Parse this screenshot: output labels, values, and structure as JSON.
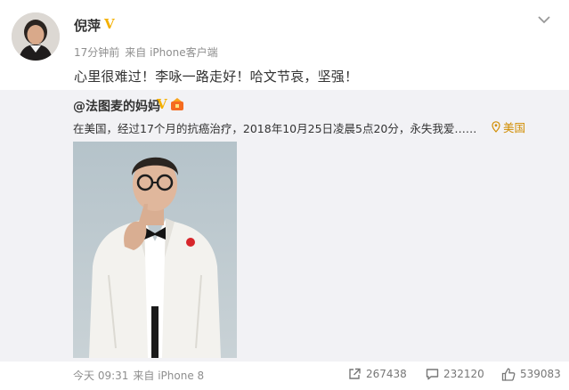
{
  "post": {
    "author": "倪萍",
    "verified_mark": "V",
    "time_ago": "17分钟前",
    "source": "来自 iPhone客户端",
    "text": "心里很难过！李咏一路走好！哈文节哀，坚强！",
    "menu_icon": "chevron-down-icon",
    "avatar_icon": "avatar"
  },
  "repost": {
    "author": "@法图麦的妈妈",
    "verified_mark": "V",
    "badge_icon": "member-badge-icon",
    "text": "在美国，经过17个月的抗癌治疗，2018年10月25日凌晨5点20分，永失我爱……",
    "location": "美国",
    "location_icon": "location-pin-icon",
    "photo_icon": "photo"
  },
  "footer": {
    "time": "今天 09:31",
    "source": "来自 iPhone 8",
    "repost_count": "267438",
    "comment_count": "232120",
    "like_count": "539083",
    "repost_icon": "repost-icon",
    "comment_icon": "comment-icon",
    "like_icon": "thumbs-up-icon"
  },
  "colors": {
    "verified": "#f4b000",
    "location": "#d18d00",
    "muted": "#8e8e8e",
    "card_bg": "#f2f2f5"
  }
}
